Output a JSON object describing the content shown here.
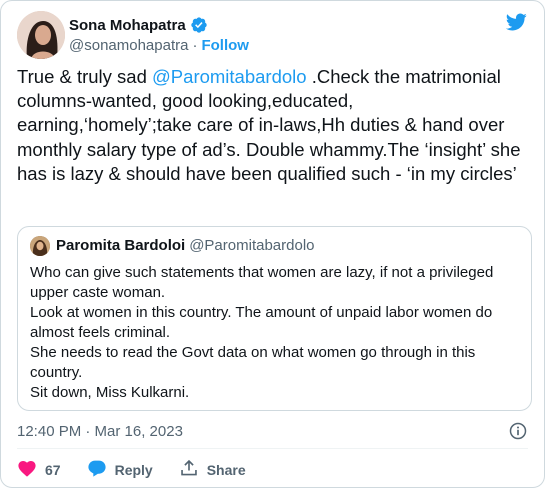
{
  "author": {
    "name": "Sona Mohapatra",
    "handle": "@sonamohapatra",
    "separator": "·",
    "follow_label": "Follow"
  },
  "tweet": {
    "text_before": "True & truly sad ",
    "mention": "@Paromitabardolo",
    "text_after": " .Check the matrimonial columns-wanted, good looking,educated, earning,‘homely’;take care of in-laws,Hh duties & hand over monthly salary type of ad’s. Double whammy.The ‘insight’ she has is lazy & should have been qualified such - ‘in my circles’"
  },
  "quoted": {
    "name": "Paromita Bardoloi",
    "handle": "@Paromitabardolo",
    "lines": [
      "Who can give such statements that women are lazy, if not a privileged upper caste woman.",
      "Look at women in this country. The amount of unpaid labor women do almost feels criminal.",
      "She needs to read the Govt data on what women go through in this country.",
      "Sit down, Miss Kulkarni."
    ]
  },
  "meta": {
    "time": "12:40 PM · Mar 16, 2023"
  },
  "actions": {
    "likes": "67",
    "reply_label": "Reply",
    "share_label": "Share"
  },
  "colors": {
    "accent": "#1d9bf0",
    "like": "#f91880",
    "text": "#0f1419",
    "muted": "#536471"
  },
  "icons": [
    "avatar",
    "verified-icon",
    "twitter-bird-icon",
    "info-icon",
    "heart-icon",
    "reply-icon",
    "share-icon"
  ]
}
